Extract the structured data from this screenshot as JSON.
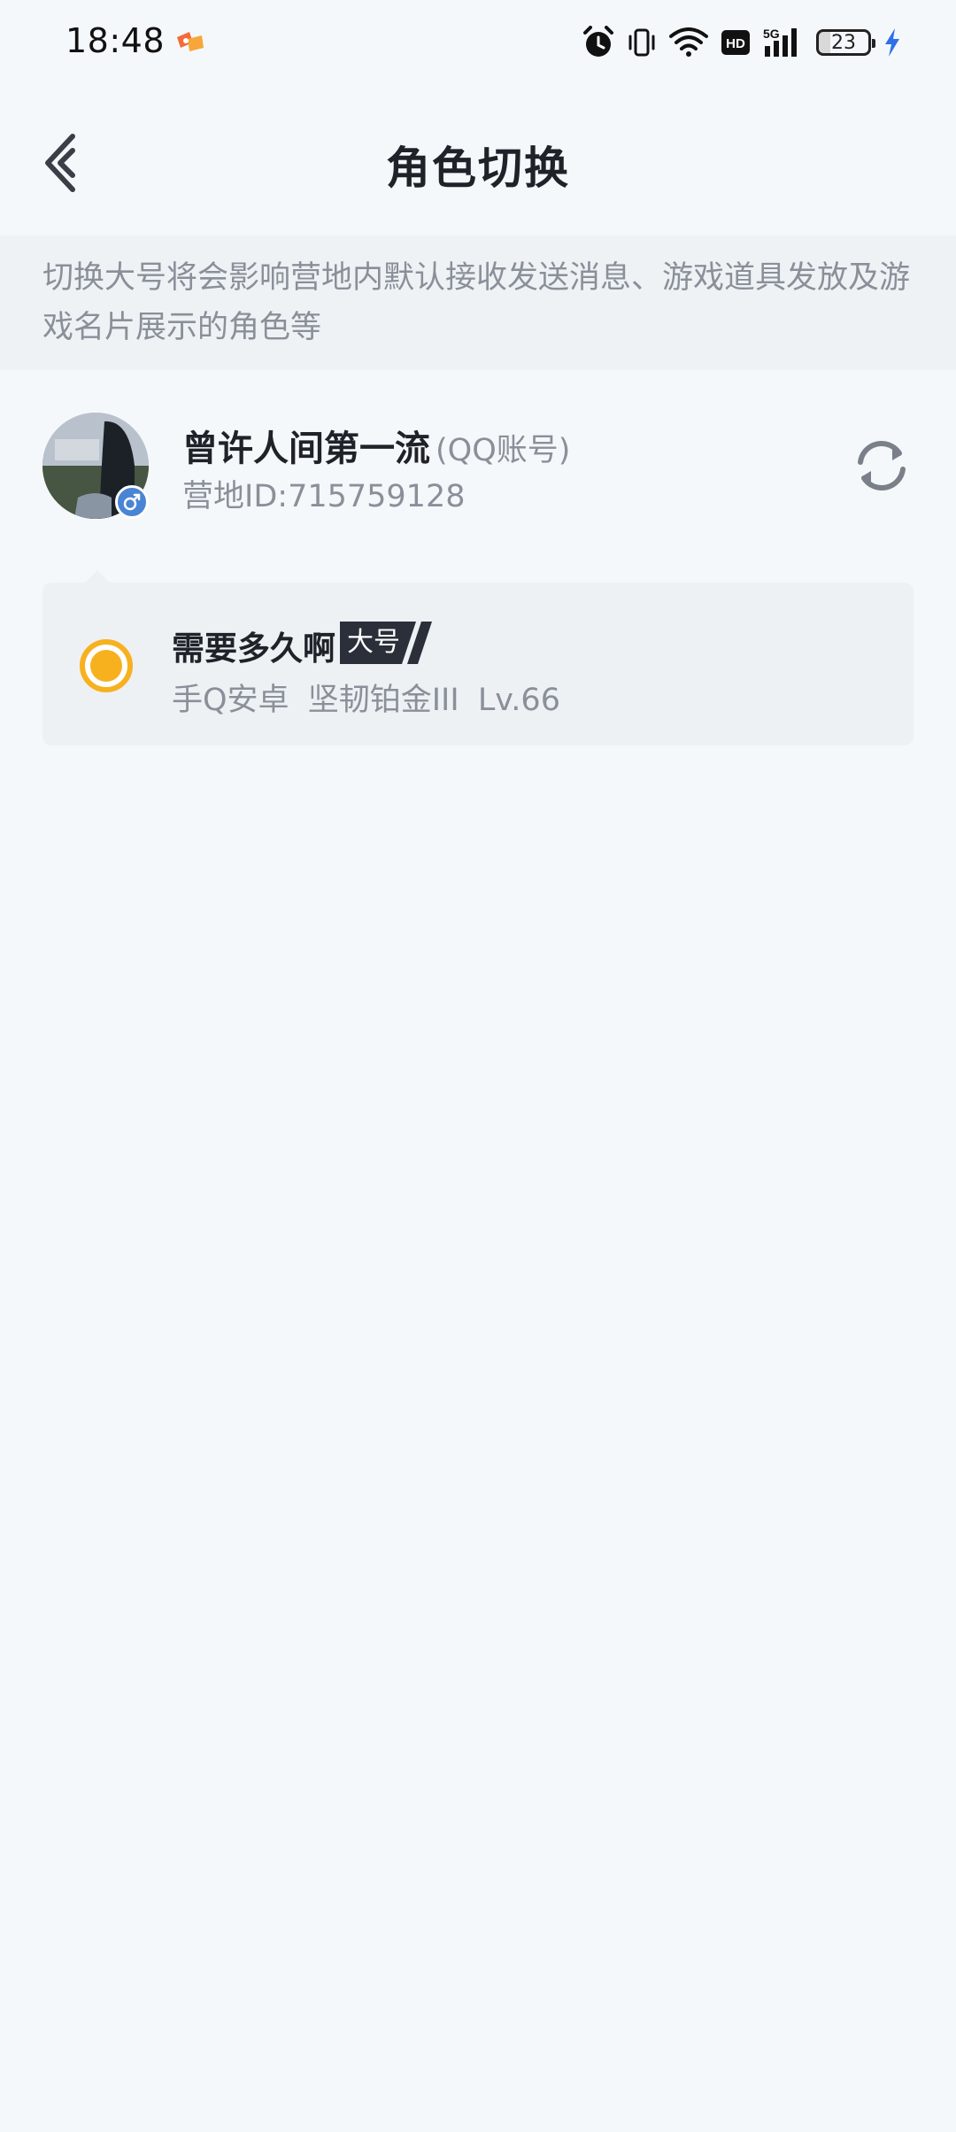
{
  "status_bar": {
    "time": "18:48",
    "battery_level": "23",
    "icons": [
      "app-notification-icon",
      "alarm-icon",
      "vibrate-icon",
      "wifi-icon",
      "hd-icon",
      "signal-5g-icon",
      "battery-icon",
      "charging-icon"
    ]
  },
  "header": {
    "title": "角色切换"
  },
  "notice": {
    "text": "切换大号将会影响营地内默认接收发送消息、游戏道具发放及游戏名片展示的角色等"
  },
  "account": {
    "name": "曾许人间第一流",
    "type": "(QQ账号)",
    "id_text": "营地ID:715759128",
    "gender": "male"
  },
  "roles": [
    {
      "name": "需要多久啊",
      "badge": "大号",
      "platform": "手Q安卓",
      "rank": "坚韧铂金III",
      "level": "Lv.66",
      "selected": true
    }
  ],
  "colors": {
    "background": "#f5f8fb",
    "notice_bg": "#eff2f5",
    "accent": "#f7b11f",
    "badge_bg": "#2a2f3a",
    "gender_badge": "#4a84d4"
  }
}
